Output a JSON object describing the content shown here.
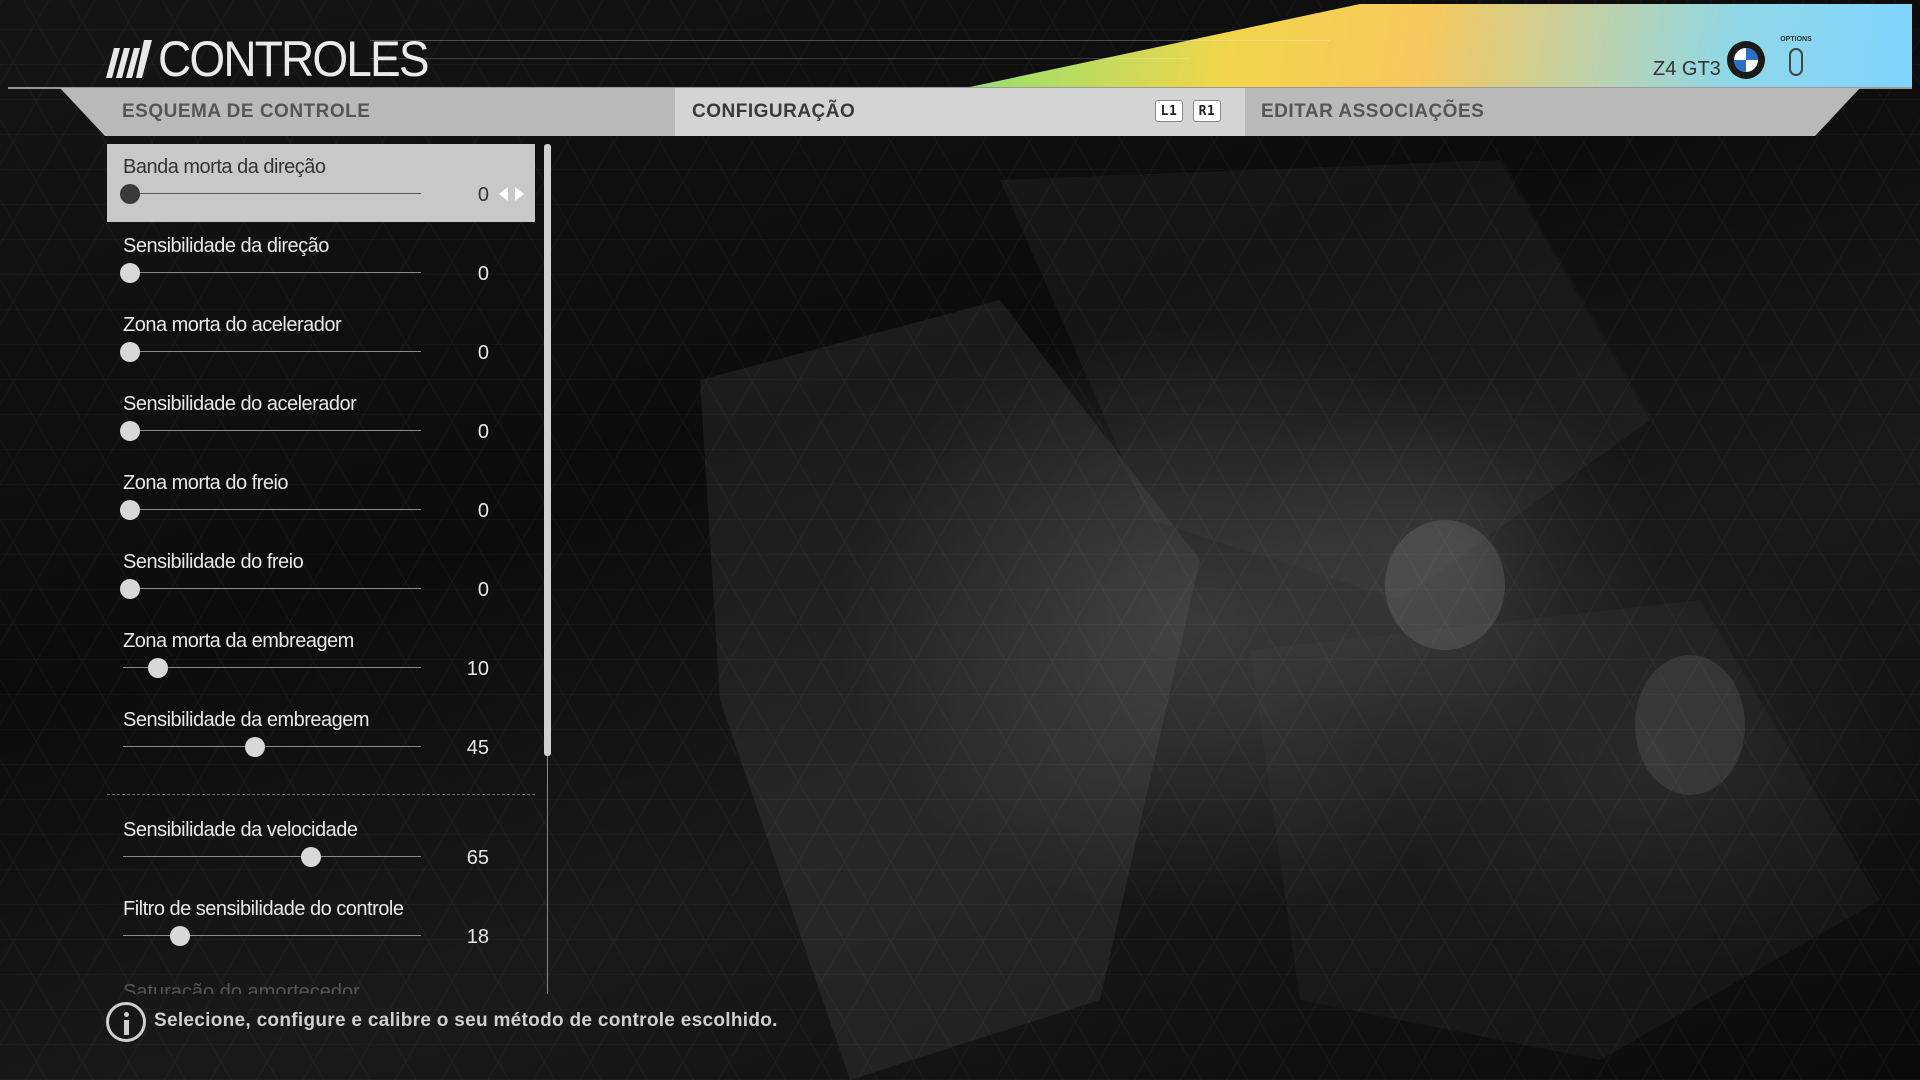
{
  "header": {
    "title": "CONTROLES",
    "car_name": "Z4 GT3",
    "options_label": "OPTIONS"
  },
  "tabs": {
    "left": "ESQUEMA DE CONTROLE",
    "active": "CONFIGURAÇÃO",
    "right": "EDITAR ASSOCIAÇÕES",
    "key_left": "L1",
    "key_right": "R1"
  },
  "settings": [
    {
      "label": "Banda morta da direção",
      "value": "0",
      "level": 0,
      "selected": true
    },
    {
      "label": "Sensibilidade da direção",
      "value": "0",
      "level": 0
    },
    {
      "label": "Zona morta do acelerador",
      "value": "0",
      "level": 0
    },
    {
      "label": "Sensibilidade do acelerador",
      "value": "0",
      "level": 0
    },
    {
      "label": "Zona morta do freio",
      "value": "0",
      "level": 0
    },
    {
      "label": "Sensibilidade do freio",
      "value": "0",
      "level": 0
    },
    {
      "label": "Zona morta da embreagem",
      "value": "10",
      "level": 10
    },
    {
      "label": "Sensibilidade da embreagem",
      "value": "45",
      "level": 45
    },
    {
      "label": "Sensibilidade da velocidade",
      "value": "65",
      "level": 65
    },
    {
      "label": "Filtro de sensibilidade do controle",
      "value": "18",
      "level": 18
    }
  ],
  "faded_next_label": "Saturação do amortecedor",
  "footer": {
    "info_text": "Selecione, configure e calibre o seu método de controle escolhido."
  },
  "colors": {
    "selected_row": "#c8c8c8",
    "tab_bar": "#b9b9b9",
    "active_tab": "#d4d4d4"
  }
}
